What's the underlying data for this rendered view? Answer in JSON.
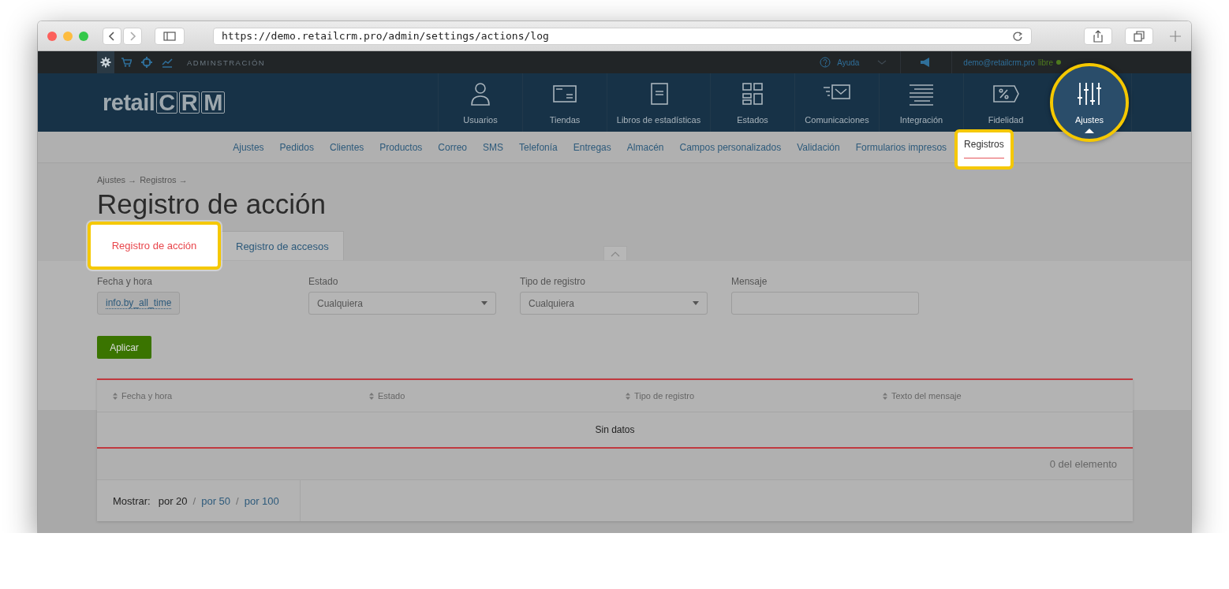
{
  "browser": {
    "url": "https://demo.retailcrm.pro/admin/settings/actions/log"
  },
  "top_bar": {
    "apps": [
      {
        "kind": "gear",
        "selected": true
      },
      {
        "kind": "cart",
        "selected": false
      },
      {
        "kind": "target",
        "selected": false
      },
      {
        "kind": "chart",
        "selected": false
      }
    ],
    "section": "ADMINSTRACIÓN",
    "help": "Ayuda",
    "user": "demo@retailcrm.pro",
    "plan": "libre"
  },
  "logo": {
    "text": "retail",
    "mark": "CRM"
  },
  "main_nav": [
    {
      "label": "Usuarios",
      "kind": "user",
      "selected": false
    },
    {
      "label": "Tiendas",
      "kind": "store",
      "selected": false
    },
    {
      "label": "Libros de estadísticas",
      "kind": "book",
      "selected": false
    },
    {
      "label": "Estados",
      "kind": "grid",
      "selected": false
    },
    {
      "label": "Comunicaciones",
      "kind": "mail",
      "selected": false
    },
    {
      "label": "Integración",
      "kind": "lines",
      "selected": false
    },
    {
      "label": "Fidelidad",
      "kind": "tag",
      "selected": false
    },
    {
      "label": "Ajustes",
      "kind": "sliders",
      "selected": true
    }
  ],
  "sub_nav": [
    {
      "label": "Ajustes",
      "selected": false
    },
    {
      "label": "Pedidos",
      "selected": false
    },
    {
      "label": "Clientes",
      "selected": false
    },
    {
      "label": "Productos",
      "selected": false
    },
    {
      "label": "Correo",
      "selected": false
    },
    {
      "label": "SMS",
      "selected": false
    },
    {
      "label": "Telefonía",
      "selected": false
    },
    {
      "label": "Entregas",
      "selected": false
    },
    {
      "label": "Almacén",
      "selected": false
    },
    {
      "label": "Campos personalizados",
      "selected": false
    },
    {
      "label": "Validación",
      "selected": false
    },
    {
      "label": "Formularios impresos",
      "selected": false
    },
    {
      "label": "Registros",
      "selected": true
    }
  ],
  "breadcrumb": [
    "Ajustes →",
    "Registros →"
  ],
  "page_title": "Registro de acción",
  "tabs": [
    {
      "label": "Registro de acción",
      "selected": true
    },
    {
      "label": "Registro de accesos",
      "selected": false
    }
  ],
  "filters": [
    {
      "kind": "date",
      "label": "Fecha y hora",
      "value": "info.by_all_time"
    },
    {
      "kind": "select",
      "label": "Estado",
      "value": "Cualquiera"
    },
    {
      "kind": "select",
      "label": "Tipo de registro",
      "value": "Cualquiera"
    },
    {
      "kind": "text",
      "label": "Mensaje"
    }
  ],
  "apply_button": "Aplicar",
  "table": {
    "columns": [
      "Fecha y hora",
      "Estado",
      "Tipo de registro",
      "Texto del mensaje"
    ],
    "empty_text": "Sin datos",
    "count": "0 del elemento"
  },
  "pagination": {
    "label": "Mostrar:",
    "options": [
      {
        "label": "por 20",
        "selected": true
      },
      {
        "label": "por 50",
        "selected": false
      },
      {
        "label": "por 100",
        "selected": false
      }
    ],
    "separators": [
      "/",
      "/"
    ]
  }
}
